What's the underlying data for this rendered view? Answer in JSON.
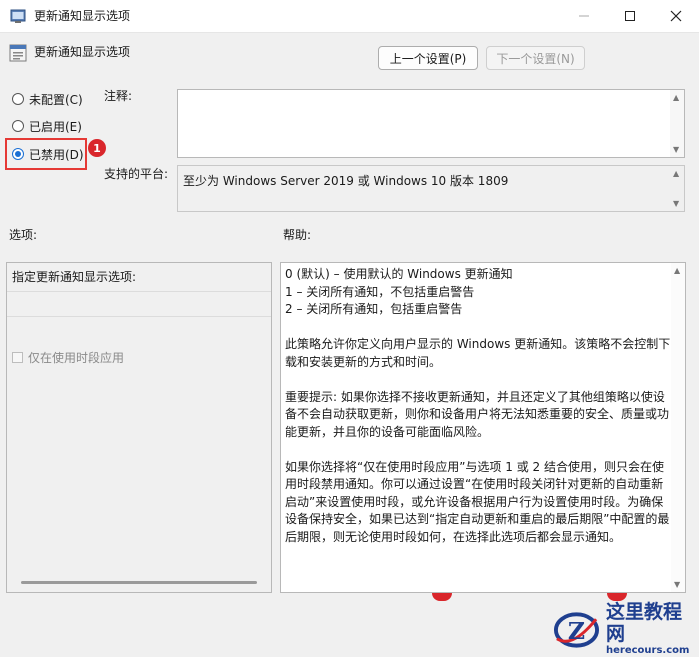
{
  "window": {
    "title": "更新通知显示选项",
    "controls": [
      "—",
      "☐",
      "✕"
    ]
  },
  "header": {
    "title": "更新通知显示选项",
    "prev_button": "上一个设置(P)",
    "next_button": "下一个设置(N)"
  },
  "state": {
    "options": [
      {
        "label": "未配置(C)",
        "checked": false
      },
      {
        "label": "已启用(E)",
        "checked": false
      },
      {
        "label": "已禁用(D)",
        "checked": true
      }
    ],
    "annotation_badge": "1"
  },
  "comment": {
    "label": "注释:",
    "value": ""
  },
  "platform": {
    "label": "支持的平台:",
    "value": "至少为 Windows Server 2019 或 Windows 10 版本 1809"
  },
  "options_panel": {
    "label": "选项:",
    "heading": "指定更新通知显示选项:",
    "checkbox_label": "仅在使用时段应用"
  },
  "help_panel": {
    "label": "帮助:",
    "lines": [
      "0 (默认) – 使用默认的 Windows 更新通知",
      "1 – 关闭所有通知，不包括重启警告",
      "2 – 关闭所有通知，包括重启警告"
    ],
    "paragraphs": [
      "此策略允许你定义向用户显示的 Windows 更新通知。该策略不会控制下载和安装更新的方式和时间。",
      "重要提示: 如果你选择不接收更新通知，并且还定义了其他组策略以使设备不会自动获取更新，则你和设备用户将无法知悉重要的安全、质量或功能更新，并且你的设备可能面临风险。",
      "如果你选择将“仅在使用时段应用”与选项 1 或 2 结合使用，则只会在使用时段禁用通知。你可以通过设置“在使用时段关闭针对更新的自动重新启动”来设置使用时段，或允许设备根据用户行为设置使用时段。为确保设备保持安全，如果已达到“指定自动更新和重启的最后期限”中配置的最后期限，则无论使用时段如何，在选择此选项后都会显示通知。"
    ]
  },
  "watermark": {
    "logo_letter": "Z",
    "site_name": "这里教程网",
    "site_url": "herecours.com"
  },
  "colors": {
    "accent": "#1a6fd4",
    "highlight": "#e53935",
    "badge": "#d9262b",
    "watermark_text": "#1f3f8f"
  }
}
